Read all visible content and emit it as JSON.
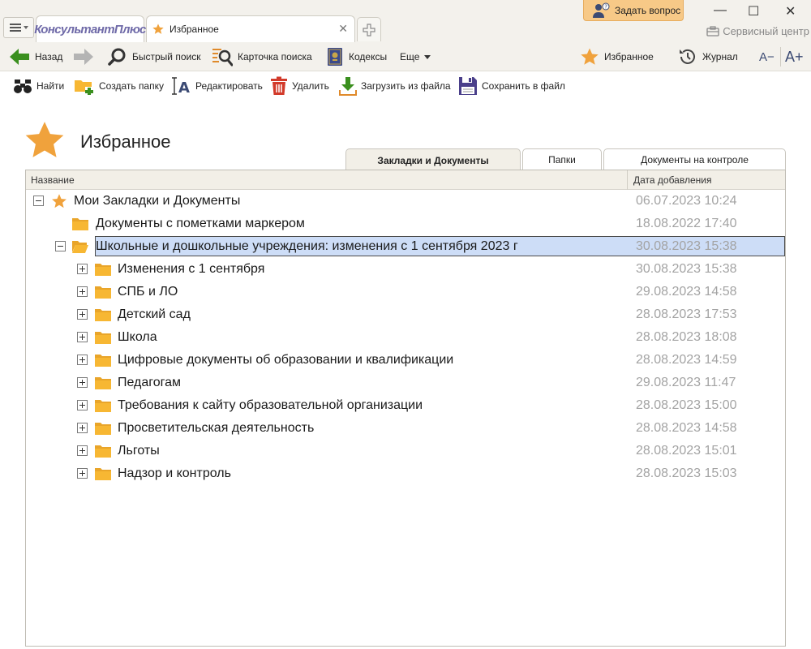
{
  "window": {
    "app_logo": "КонсультантПлюс",
    "active_tab_title": "Избранное",
    "ask_question": "Задать вопрос",
    "service_center": "Сервисный центр",
    "controls": {
      "minimize": "—",
      "maximize": "☐",
      "close": "✕"
    }
  },
  "toolbar": {
    "back": "Назад",
    "quick_search": "Быстрый поиск",
    "search_card": "Карточка поиска",
    "codes": "Кодексы",
    "more": "Еще",
    "favorites": "Избранное",
    "journal": "Журнал",
    "font_smaller": "A−",
    "font_larger": "A+"
  },
  "actions": {
    "find": "Найти",
    "create_folder": "Создать папку",
    "edit": "Редактировать",
    "delete": "Удалить",
    "load_from_file": "Загрузить из файла",
    "save_to_file": "Сохранить в файл"
  },
  "page": {
    "title": "Избранное"
  },
  "view_tabs": [
    {
      "label": "Закладки и Документы",
      "active": true
    },
    {
      "label": "Папки",
      "active": false
    },
    {
      "label": "Документы на контроле",
      "active": false
    }
  ],
  "columns": {
    "name": "Название",
    "date_added": "Дата добавления"
  },
  "tree": [
    {
      "label": "Мои Закладки и Документы",
      "date": "06.07.2023 10:24",
      "level": 0,
      "icon": "star-icon",
      "toggle": "minus"
    },
    {
      "label": "Документы с пометками маркером",
      "date": "18.08.2022 17:40",
      "level": 1,
      "icon": "folder-icon",
      "toggle": "none"
    },
    {
      "label": "Школьные и дошкольные учреждения: изменения с 1 сентября 2023 г",
      "date": "30.08.2023 15:38",
      "level": 1,
      "icon": "folder-open-icon",
      "toggle": "minus",
      "selected": true
    },
    {
      "label": "Изменения с 1 сентября",
      "date": "30.08.2023 15:38",
      "level": 2,
      "icon": "folder-icon",
      "toggle": "plus"
    },
    {
      "label": "СПБ и ЛО",
      "date": "29.08.2023 14:58",
      "level": 2,
      "icon": "folder-icon",
      "toggle": "plus"
    },
    {
      "label": "Детский сад",
      "date": "28.08.2023 17:53",
      "level": 2,
      "icon": "folder-icon",
      "toggle": "plus"
    },
    {
      "label": "Школа",
      "date": "28.08.2023 18:08",
      "level": 2,
      "icon": "folder-icon",
      "toggle": "plus"
    },
    {
      "label": "Цифровые документы об образовании и квалификации",
      "date": "28.08.2023 14:59",
      "level": 2,
      "icon": "folder-icon",
      "toggle": "plus"
    },
    {
      "label": "Педагогам",
      "date": "29.08.2023 11:47",
      "level": 2,
      "icon": "folder-icon",
      "toggle": "plus"
    },
    {
      "label": "Требования к сайту образовательной организации",
      "date": "28.08.2023 15:00",
      "level": 2,
      "icon": "folder-icon",
      "toggle": "plus"
    },
    {
      "label": "Просветительская деятельность",
      "date": "28.08.2023 14:58",
      "level": 2,
      "icon": "folder-icon",
      "toggle": "plus"
    },
    {
      "label": "Льготы",
      "date": "28.08.2023 15:01",
      "level": 2,
      "icon": "folder-icon",
      "toggle": "plus"
    },
    {
      "label": "Надзор и контроль",
      "date": "28.08.2023 15:03",
      "level": 2,
      "icon": "folder-icon",
      "toggle": "plus"
    }
  ],
  "colors": {
    "accent_star": "#f0a23c",
    "folder": "#f7b733",
    "selection": "#cdddf7",
    "back_arrow": "#3a8f1e",
    "delete_red": "#d23a2a",
    "logo": "#6f6aa8"
  }
}
